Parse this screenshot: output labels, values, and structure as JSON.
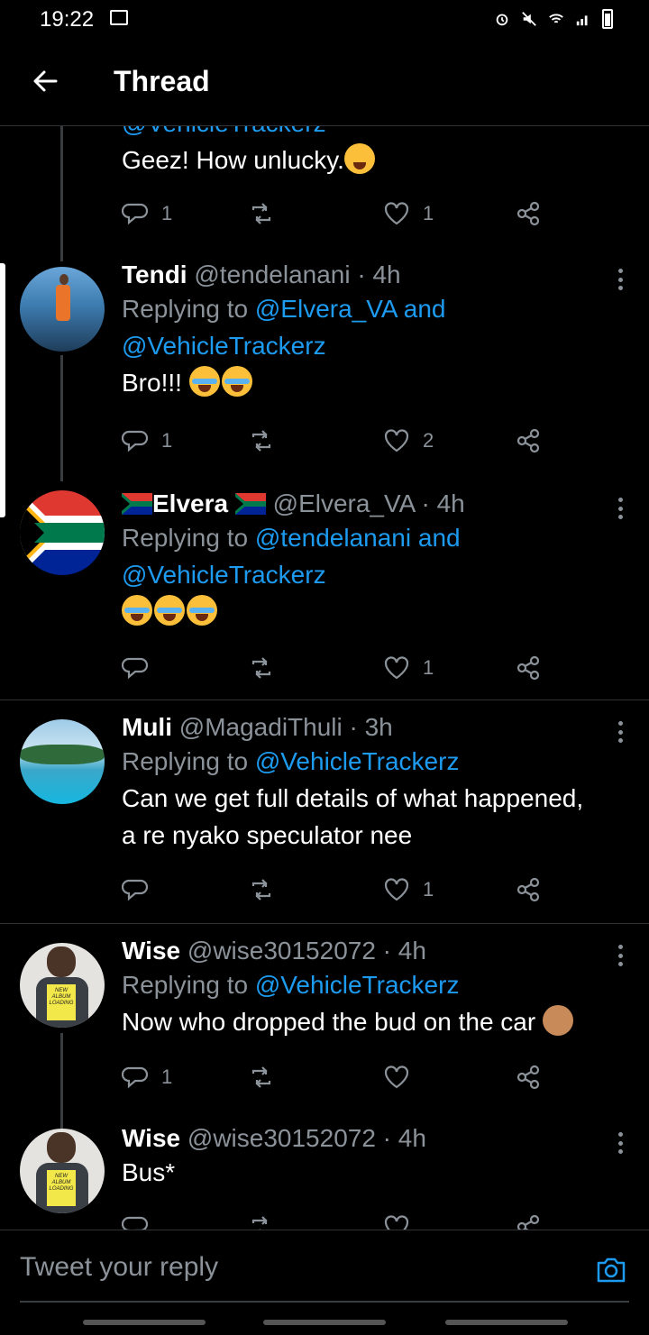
{
  "status_bar": {
    "time": "19:22"
  },
  "header": {
    "title": "Thread"
  },
  "top_tweet": {
    "reply_partial": "@VehicleTrackerz",
    "body": "Geez! How unlucky.",
    "replies": "1",
    "retweets": "",
    "likes": "1"
  },
  "tweets": [
    {
      "name": "Tendi",
      "handle": "@tendelanani · 4h",
      "replying_prefix": "Replying to",
      "mention1": "@Elvera_VA",
      "and": "and",
      "mention2": "@VehicleTrackerz",
      "body": "Bro!!!",
      "replies": "1",
      "retweets": "",
      "likes": "2"
    },
    {
      "name": "Elvera",
      "handle": "@Elvera_VA · 4h",
      "replying_prefix": "Replying to",
      "mention1": "@tendelanani",
      "and": "and",
      "mention2": "@VehicleTrackerz",
      "body": "",
      "replies": "",
      "retweets": "",
      "likes": "1"
    },
    {
      "name": "Muli",
      "handle": "@MagadiThuli · 3h",
      "replying_prefix": "Replying to",
      "mention1": "@VehicleTrackerz",
      "body_line1": "Can we get full details of what happened,",
      "body_line2": "a re nyako speculator nee",
      "replies": "",
      "retweets": "",
      "likes": "1"
    },
    {
      "name": "Wise",
      "handle": "@wise30152072 · 4h",
      "replying_prefix": "Replying to",
      "mention1": "@VehicleTrackerz",
      "body": "Now who dropped the bud on the car",
      "replies": "1",
      "retweets": "",
      "likes": ""
    },
    {
      "name": "Wise",
      "handle": "@wise30152072 · 4h",
      "body": "Bus*"
    }
  ],
  "avatar_sign_text": "NEW ALBUM LOADING",
  "reply_box": {
    "placeholder": "Tweet your reply"
  },
  "colors": {
    "background": "#000000",
    "accent": "#1d9bf0",
    "muted": "#8b9299",
    "divider": "#2f3336"
  }
}
